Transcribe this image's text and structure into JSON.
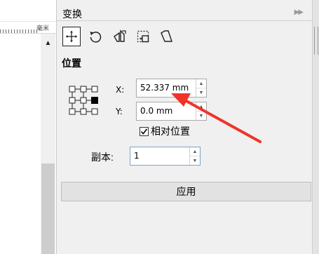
{
  "ruler": {
    "unit": "毫米"
  },
  "docker": {
    "title": "变换",
    "collapse_glyph": "▶▶",
    "tools": [
      {
        "name": "position-tool",
        "icon": "move-cross-icon",
        "active": true
      },
      {
        "name": "rotate-tool",
        "icon": "rotate-icon",
        "active": false
      },
      {
        "name": "scale-mirror-tool",
        "icon": "scale-mirror-icon",
        "active": false
      },
      {
        "name": "size-tool",
        "icon": "size-icon",
        "active": false
      },
      {
        "name": "skew-tool",
        "icon": "skew-icon",
        "active": false
      }
    ],
    "section_title": "位置",
    "x_label": "X:",
    "x_value": "52.337 mm",
    "y_label": "Y:",
    "y_value": "0.0 mm",
    "relative_position_label": "相对位置",
    "relative_position_checked": true,
    "copies_label": "副本:",
    "copies_value": "1",
    "apply_label": "应用"
  },
  "annotation": {
    "arrow_color": "#f0332a"
  }
}
